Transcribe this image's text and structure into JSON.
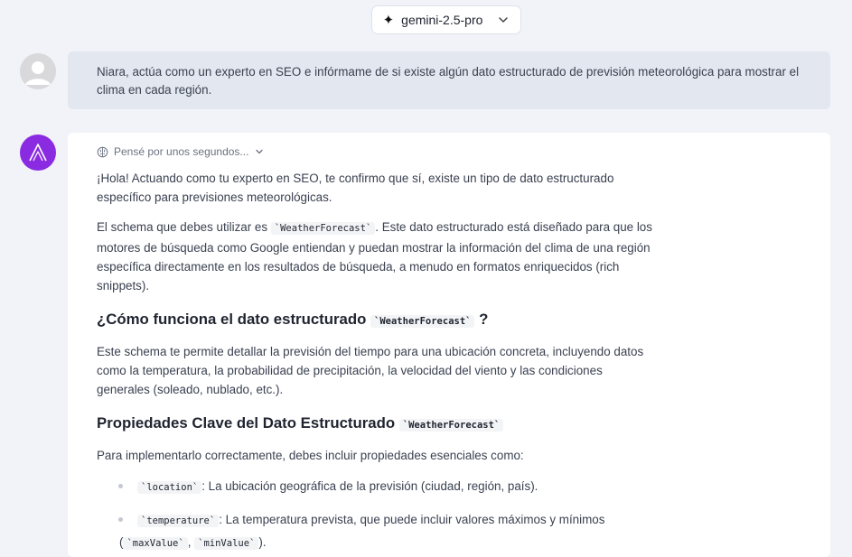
{
  "model_selector": {
    "label": "gemini-2.5-pro"
  },
  "user_message": {
    "text": "Niara, actúa como un experto en SEO e infórmame de si existe algún dato estructurado de previsión meteorológica para mostrar el clima en cada región."
  },
  "assistant_message": {
    "thinking_label": "Pensé por unos segundos...",
    "p1": "¡Hola! Actuando como tu experto en SEO, te confirmo que sí, existe un tipo de dato estructurado específico para previsiones meteorológicas.",
    "p2_a": "El schema que debes utilizar es ",
    "p2_code": "`WeatherForecast`",
    "p2_b": ". Este dato estructurado está diseñado para que los motores de búsqueda como Google entiendan y puedan mostrar la información del clima de una región específica directamente en los resultados de búsqueda, a menudo en formatos enriquecidos (rich snippets).",
    "h1_a": "¿Cómo funciona el dato estructurado ",
    "h1_code": "`WeatherForecast`",
    "h1_b": "?",
    "p3": "Este schema te permite detallar la previsión del tiempo para una ubicación concreta, incluyendo datos como la temperatura, la probabilidad de precipitación, la velocidad del viento y las condiciones generales (soleado, nublado, etc.).",
    "h2_a": "Propiedades Clave del Dato Estructurado ",
    "h2_code": "`WeatherForecast`",
    "p4": "Para implementarlo correctamente, debes incluir propiedades esenciales como:",
    "list": [
      {
        "code": "`location`",
        "text": ": La ubicación geográfica de la previsión (ciudad, región, país)."
      },
      {
        "code": "`temperature`",
        "text": ": La temperatura prevista, que puede incluir valores máximos y mínimos",
        "cont_a": "(",
        "code2": "`maxValue`",
        "cont_b": ", ",
        "code3": "`minValue`",
        "cont_c": ")."
      }
    ]
  },
  "colors": {
    "bot_avatar": "#8a2be2",
    "background": "#f1f3f8",
    "user_bubble": "#e3e7ef"
  }
}
